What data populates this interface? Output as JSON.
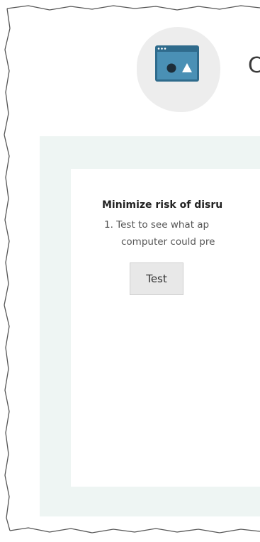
{
  "header": {
    "icon": "browser-window-shapes-icon",
    "title_fragment": "C"
  },
  "section": {
    "title": "Minimize risk of disru",
    "steps": [
      {
        "line1": "1. Test to see what ap",
        "line2": "computer could pre"
      }
    ],
    "test_button_label": "Test"
  },
  "colors": {
    "panel_background": "#eef5f3",
    "icon_blob": "#ededed",
    "icon_frame": "#2f6b8c",
    "icon_body": "#4a90b5"
  }
}
